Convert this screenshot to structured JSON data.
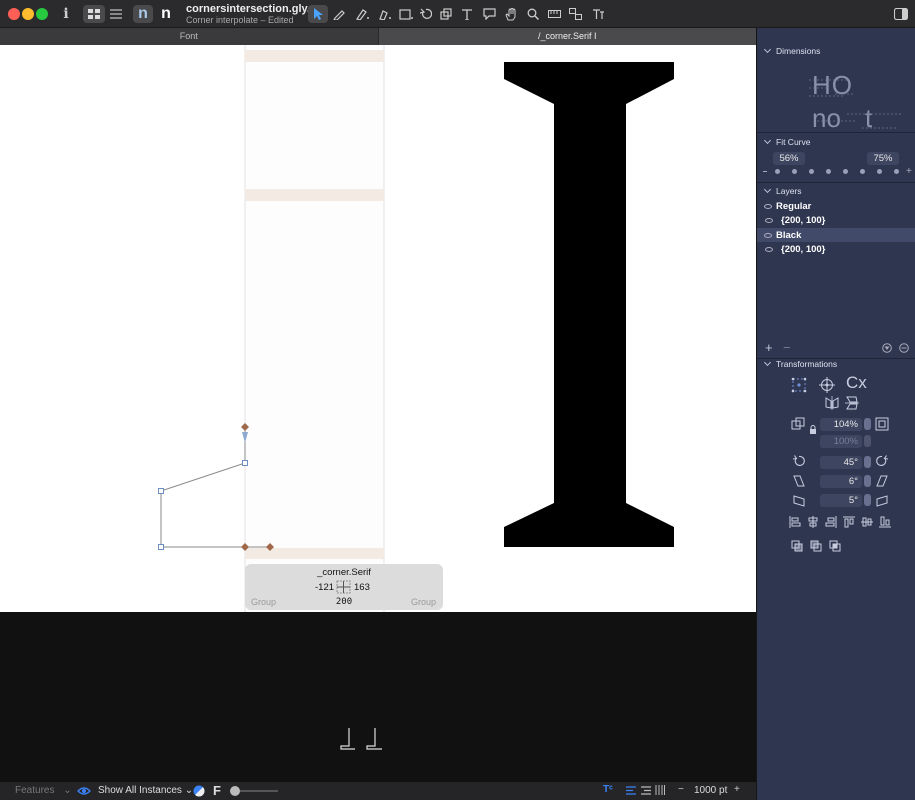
{
  "window": {
    "title": "cornersintersection.gly...",
    "subtitle": "Corner interpolate – Edited"
  },
  "toolbar": {
    "info_glyph": "i",
    "n_light": "n",
    "n_bold": "n"
  },
  "tabs": [
    {
      "label": "Font",
      "active": false
    },
    {
      "label": "/_corner.Serif I",
      "active": true
    }
  ],
  "panel": {
    "dimensions": {
      "header": "Dimensions",
      "preview_text_1": "HO",
      "preview_text_2": "no",
      "preview_text_3": "t"
    },
    "fit_curve": {
      "header": "Fit Curve",
      "left_value": "56%",
      "right_value": "75%"
    },
    "layers": {
      "header": "Layers",
      "items": [
        {
          "label": "Regular",
          "bold": true,
          "selected": false
        },
        {
          "label": "{200, 100}",
          "bold": false,
          "selected": false
        },
        {
          "label": "Black",
          "bold": true,
          "selected": true
        },
        {
          "label": "{200, 100}",
          "bold": false,
          "selected": false
        }
      ],
      "add_label": "+",
      "remove_label": "−"
    },
    "transformations": {
      "header": "Transformations",
      "cx_label": "Cx",
      "scale_value": "104%",
      "scale_value_2": "100%",
      "rotate_value": "45°",
      "slant_value": "6°",
      "skew_value": "5°"
    }
  },
  "info_box": {
    "name": "_corner.Serif",
    "x_value": "-121",
    "y_value": "163",
    "left_label": "Group",
    "center_value": "200",
    "right_label": "Group"
  },
  "statusbar": {
    "features_label": "Features",
    "instances_label": "Show All Instances",
    "f_label": "F",
    "zoom_value": "1000 pt",
    "minus": "−",
    "plus": "+"
  },
  "colors": {
    "panel_bg": "#2f3650",
    "node_brown": "#a0694a",
    "node_blue": "#6a8fc0",
    "accent_blue": "#3b82f6"
  }
}
